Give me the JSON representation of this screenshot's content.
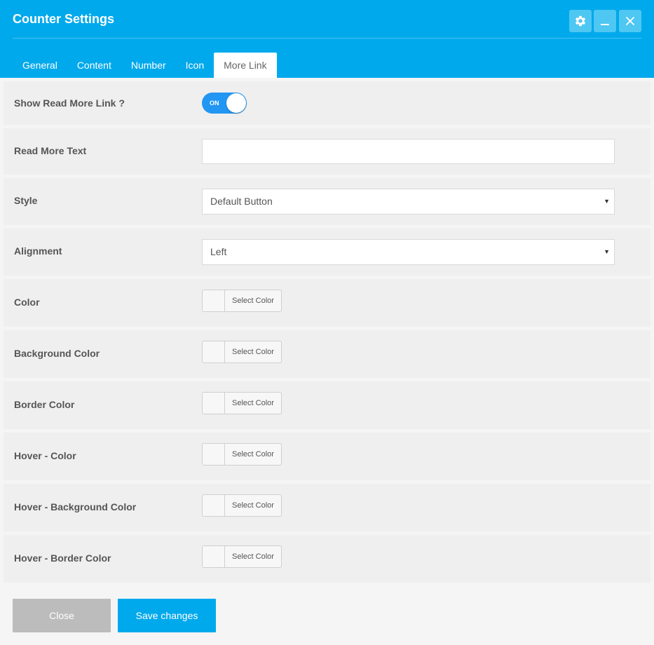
{
  "header": {
    "title": "Counter Settings",
    "buttons": [
      {
        "icon": "gear-icon"
      },
      {
        "icon": "minimize-icon"
      },
      {
        "icon": "close-icon"
      }
    ]
  },
  "tabs": [
    {
      "label": "General",
      "active": false
    },
    {
      "label": "Content",
      "active": false
    },
    {
      "label": "Number",
      "active": false
    },
    {
      "label": "Icon",
      "active": false
    },
    {
      "label": "More Link",
      "active": true
    }
  ],
  "fields": {
    "show_read_more": {
      "label": "Show Read More Link ?",
      "toggle_text": "ON",
      "value": true
    },
    "read_more_text": {
      "label": "Read More Text",
      "value": "",
      "placeholder": ""
    },
    "style": {
      "label": "Style",
      "value": "Default Button"
    },
    "alignment": {
      "label": "Alignment",
      "value": "Left"
    },
    "colors": [
      {
        "label": "Color",
        "button": "Select Color"
      },
      {
        "label": "Background Color",
        "button": "Select Color"
      },
      {
        "label": "Border Color",
        "button": "Select Color"
      },
      {
        "label": "Hover - Color",
        "button": "Select Color"
      },
      {
        "label": "Hover - Background Color",
        "button": "Select Color"
      },
      {
        "label": "Hover - Border Color",
        "button": "Select Color"
      }
    ]
  },
  "footer": {
    "close_label": "Close",
    "save_label": "Save changes"
  },
  "colors": {
    "accent": "#00a9ec",
    "toggle_on": "#2196f3",
    "close_button": "#bcbcbc"
  }
}
